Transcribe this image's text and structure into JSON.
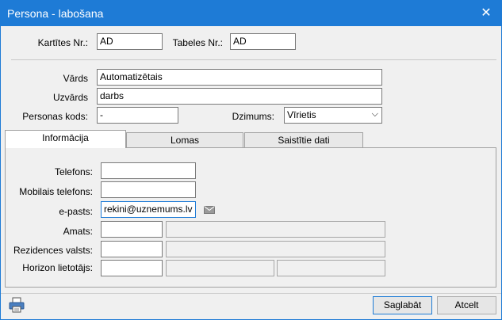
{
  "window": {
    "title": "Persona - labošana",
    "close_glyph": "✕"
  },
  "header_fields": {
    "card_label": "Kartītes Nr.:",
    "card_value": "AD",
    "table_label": "Tabeles Nr.:",
    "table_value": "AD"
  },
  "person": {
    "first_name_label": "Vārds",
    "first_name_value": "Automatizētais",
    "last_name_label": "Uzvārds",
    "last_name_value": "darbs",
    "personal_code_label": "Personas kods:",
    "personal_code_value": "-",
    "gender_label": "Dzimums:",
    "gender_value": "Vīrietis"
  },
  "tabs": [
    {
      "label": "Informācija",
      "active": true
    },
    {
      "label": "Lomas",
      "active": false
    },
    {
      "label": "Saistītie dati",
      "active": false
    }
  ],
  "info": {
    "phone_label": "Telefons:",
    "phone_value": "",
    "mobile_label": "Mobilais telefons:",
    "mobile_value": "",
    "email_label": "e-pasts:",
    "email_value": "rekini@uznemums.lv",
    "position_label": "Amats:",
    "position_code": "",
    "position_name": "",
    "residence_label": "Rezidences valsts:",
    "residence_code": "",
    "residence_name": "",
    "horizon_label": "Horizon lietotājs:",
    "horizon_code": "",
    "horizon_name": "",
    "horizon_extra": ""
  },
  "footer": {
    "save_label": "Saglabāt",
    "cancel_label": "Atcelt"
  },
  "icons": {
    "print": "printer-icon",
    "mail": "envelope-icon",
    "close": "close-icon",
    "dropdown": "chevron-down-icon"
  },
  "colors": {
    "accent": "#1e7bd6"
  }
}
